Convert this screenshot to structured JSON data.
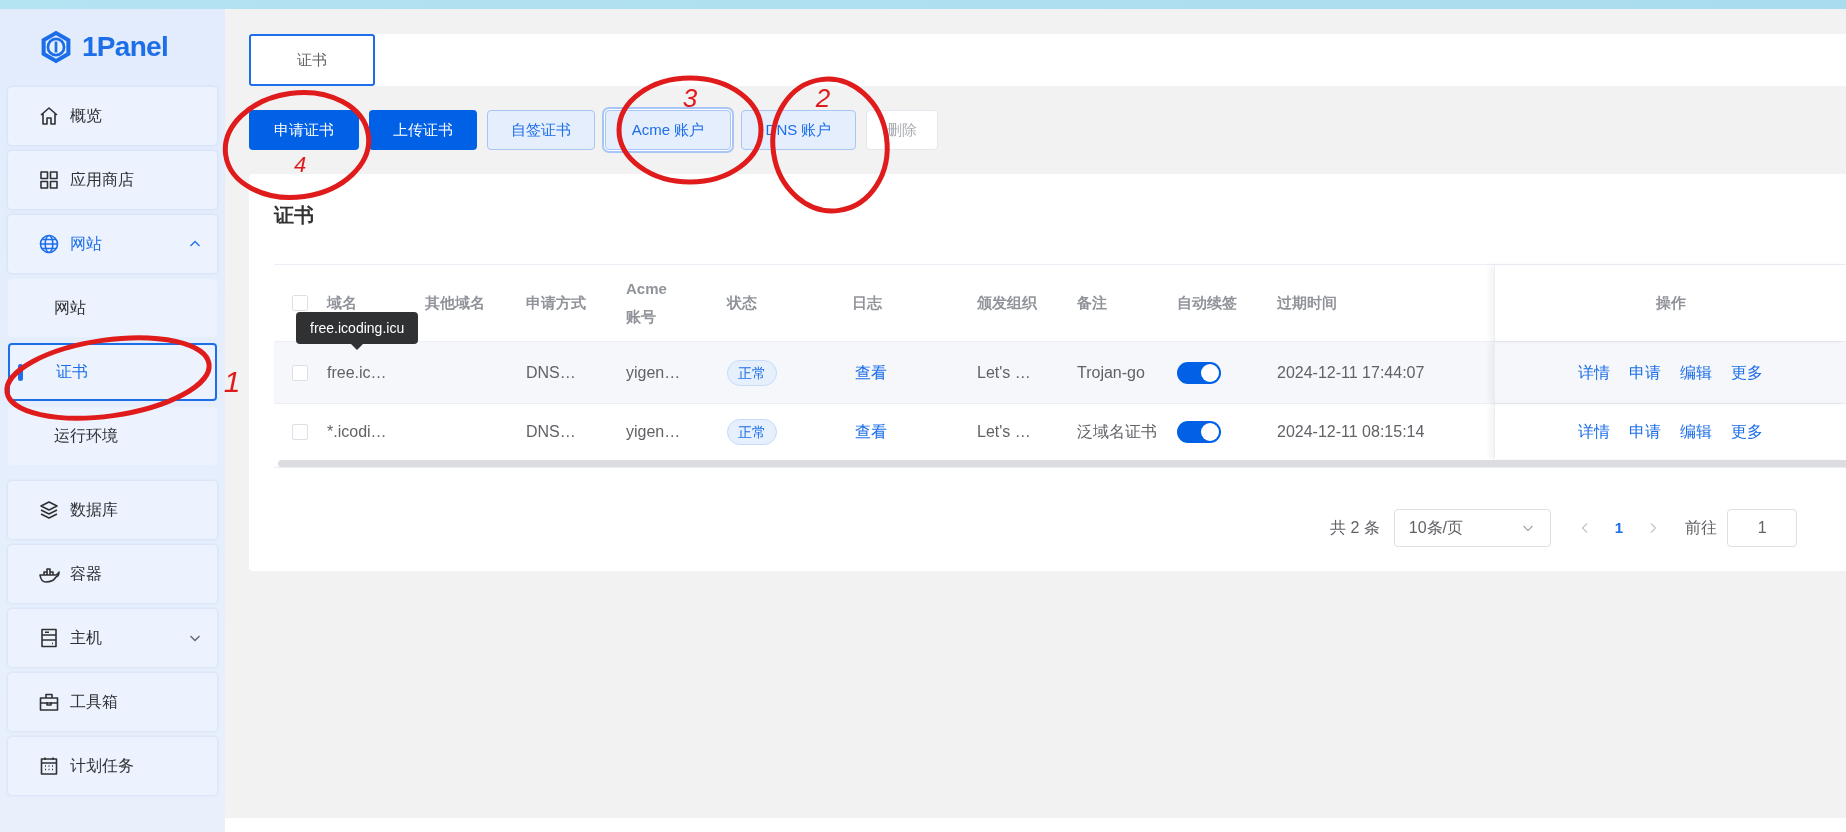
{
  "sidebar": {
    "logo": "1Panel",
    "items": [
      {
        "label": "概览",
        "expanded": false,
        "selected": false
      },
      {
        "label": "应用商店",
        "expanded": false,
        "selected": false
      },
      {
        "label": "网站",
        "expanded": true,
        "selected": false,
        "children": [
          {
            "label": "网站",
            "selected": false
          },
          {
            "label": "证书",
            "selected": true
          },
          {
            "label": "运行环境",
            "selected": false
          }
        ]
      },
      {
        "label": "数据库",
        "expanded": false,
        "selected": false
      },
      {
        "label": "容器",
        "expanded": false,
        "selected": false
      },
      {
        "label": "主机",
        "expanded": false,
        "selected": false,
        "has_children": true
      },
      {
        "label": "工具箱",
        "expanded": false,
        "selected": false
      },
      {
        "label": "计划任务",
        "expanded": false,
        "selected": false
      }
    ]
  },
  "tabs": [
    {
      "label": "证书",
      "selected": true
    }
  ],
  "toolbar": [
    {
      "label": "申请证书",
      "kind": "primary",
      "focused": false
    },
    {
      "label": "上传证书",
      "kind": "primary",
      "focused": false
    },
    {
      "label": "自签证书",
      "kind": "light",
      "focused": false
    },
    {
      "label": "Acme 账户",
      "kind": "light",
      "focused": true
    },
    {
      "label": "DNS 账户",
      "kind": "light",
      "focused": false
    },
    {
      "label": "删除",
      "kind": "disabled",
      "focused": false
    }
  ],
  "card": {
    "title": "证书",
    "table": {
      "select_all_checked": false,
      "columns": [
        "域名",
        "其他域名",
        "申请方式",
        "Acme 账号",
        "状态",
        "日志",
        "颁发组织",
        "备注",
        "自动续签",
        "过期时间",
        "操作"
      ],
      "rows": [
        {
          "checked": false,
          "hover": true,
          "domain": "free.ic…",
          "method": "DNS…",
          "acme_account": "yigen…",
          "status": "正常",
          "log": "查看",
          "issuer": "Let's …",
          "remark": "Trojan-go",
          "auto_renew": true,
          "expires": "2024-12-11 17:44:07",
          "actions": [
            "详情",
            "申请",
            "编辑",
            "更多"
          ]
        },
        {
          "checked": false,
          "hover": false,
          "domain": "*.icodi…",
          "method": "DNS…",
          "acme_account": "yigen…",
          "status": "正常",
          "log": "查看",
          "issuer": "Let's …",
          "remark": "泛域名证书",
          "auto_renew": true,
          "expires": "2024-12-11 08:15:14",
          "actions": [
            "详情",
            "申请",
            "编辑",
            "更多"
          ]
        }
      ],
      "tooltip": "free.icoding.icu"
    },
    "pagination": {
      "total": "共 2 条",
      "page_size": "10条/页",
      "pages": [
        {
          "label": "1",
          "selected": true
        }
      ],
      "goto_label": "前往",
      "goto_value": "1"
    }
  },
  "annotations": [
    {
      "label": "4"
    },
    {
      "label": "1"
    },
    {
      "label": "3"
    },
    {
      "label": "2"
    }
  ]
}
